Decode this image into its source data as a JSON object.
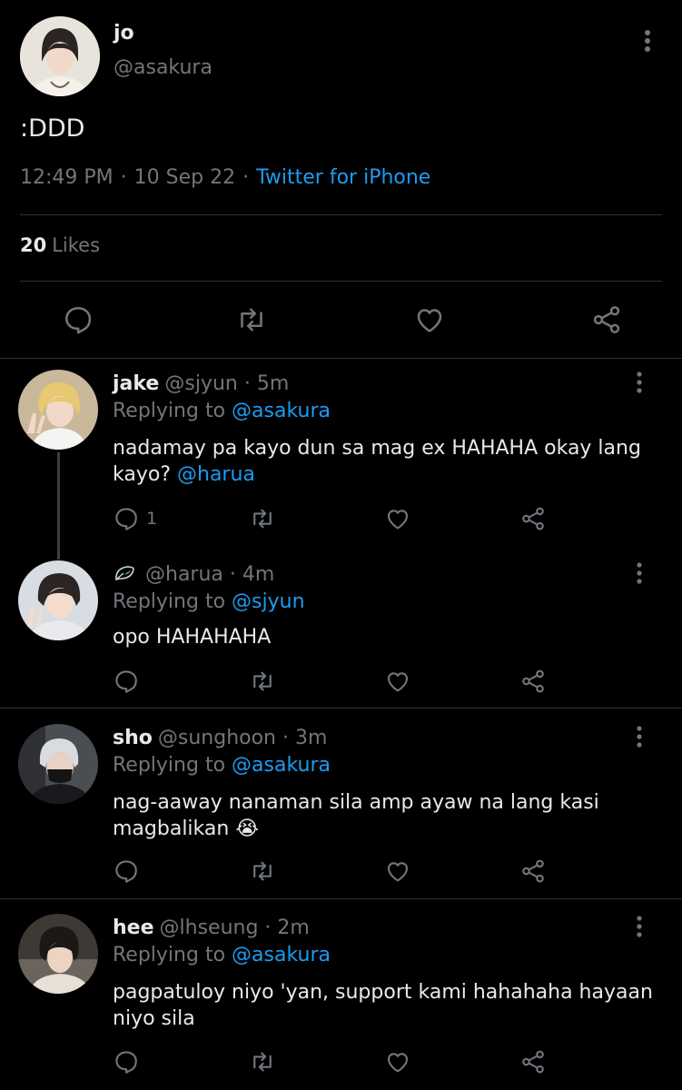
{
  "main_tweet": {
    "display_name": "jo",
    "handle": "@asakura",
    "text": ":DDD",
    "time": "12:49 PM",
    "date": "10 Sep 22",
    "source": "Twitter for iPhone",
    "likes_count": "20",
    "likes_label": "Likes",
    "avatar_icon": "user-avatar",
    "actions": [
      "reply-icon",
      "retweet-icon",
      "like-icon",
      "share-icon"
    ]
  },
  "replies": [
    {
      "display_name": "jake",
      "handle": "@sjyun",
      "time": "5m",
      "replying_label": "Replying to",
      "replying_to": "@asakura",
      "text": "nadamay pa kayo dun sa mag ex HAHAHA okay lang kayo?",
      "mention": "@harua",
      "reply_count": "1"
    },
    {
      "display_name": "",
      "handle": "@harua",
      "time": "4m",
      "replying_label": "Replying to",
      "replying_to": "@sjyun",
      "text": "opo HAHAHAHA",
      "name_icon": "leaf-icon"
    },
    {
      "display_name": "sho",
      "handle": "@sunghoon",
      "time": "3m",
      "replying_label": "Replying to",
      "replying_to": "@asakura",
      "text": "nag-aaway nanaman sila amp ayaw na lang kasi magbalikan",
      "emoji": "😭"
    },
    {
      "display_name": "hee",
      "handle": "@lhseung",
      "time": "2m",
      "replying_label": "Replying to",
      "replying_to": "@asakura",
      "text": "pagpatuloy niyo 'yan, support kami hahahaha hayaan niyo sila"
    }
  ],
  "colors": {
    "background": "#000000",
    "text": "#e7e9ea",
    "muted": "#71767b",
    "link": "#1d9bf0",
    "divider": "#2f3336"
  }
}
